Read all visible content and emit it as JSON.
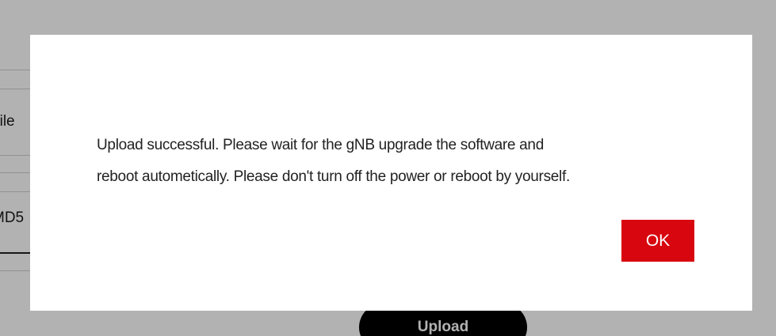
{
  "background": {
    "labels": [
      "File",
      "MD5"
    ],
    "upload_label": "Upload"
  },
  "dialog": {
    "message_line1": "Upload successful. Please wait for the gNB upgrade the software and",
    "message_line2": "reboot autometically. Please don't turn off the power or reboot by yourself.",
    "ok_label": "OK"
  },
  "colors": {
    "accent": "#d8060f",
    "overlay": "rgba(0,0,0,0.3)",
    "upload_button": "#000000"
  }
}
